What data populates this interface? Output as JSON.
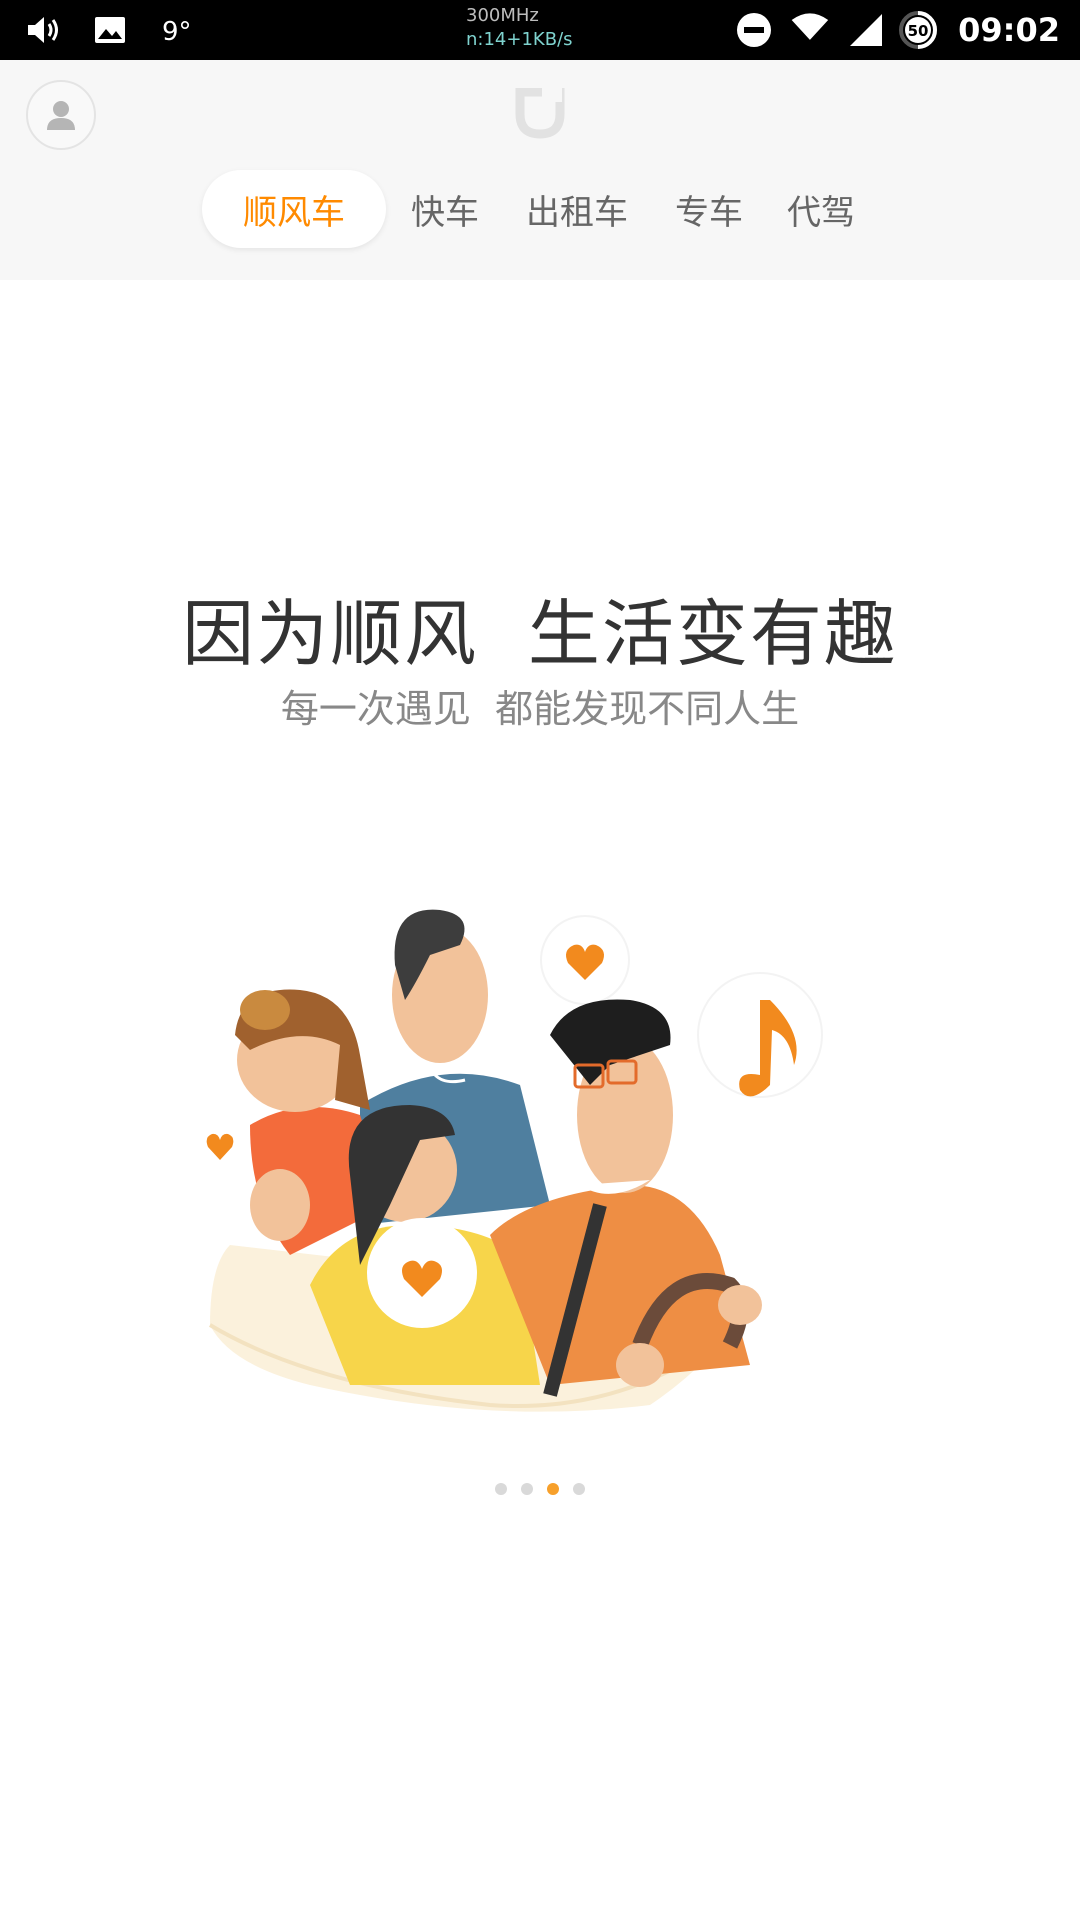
{
  "status_bar": {
    "cpu_freq": "300MHz",
    "net_speed": "n:14+1KB/s",
    "battery_level": "50",
    "time": "09:02",
    "icons": [
      "volume-icon",
      "gallery-icon",
      "weather-icon",
      "dnd-icon",
      "wifi-icon",
      "signal-icon",
      "battery-icon"
    ]
  },
  "header": {
    "tabs": [
      {
        "label": "顺风车",
        "active": true
      },
      {
        "label": "快车",
        "active": false
      },
      {
        "label": "出租车",
        "active": false
      },
      {
        "label": "专车",
        "active": false
      },
      {
        "label": "代驾",
        "active": false
      }
    ]
  },
  "onboarding": {
    "headline": "因为顺风  生活变有趣",
    "subline": "每一次遇见  都能发现不同人生",
    "page_count": 4,
    "current_page": 3
  },
  "colors": {
    "accent": "#ff8a00",
    "dot_active": "#f7a02b",
    "dot_inactive": "#d9d9d9",
    "header_bg": "#f7f7f7"
  }
}
